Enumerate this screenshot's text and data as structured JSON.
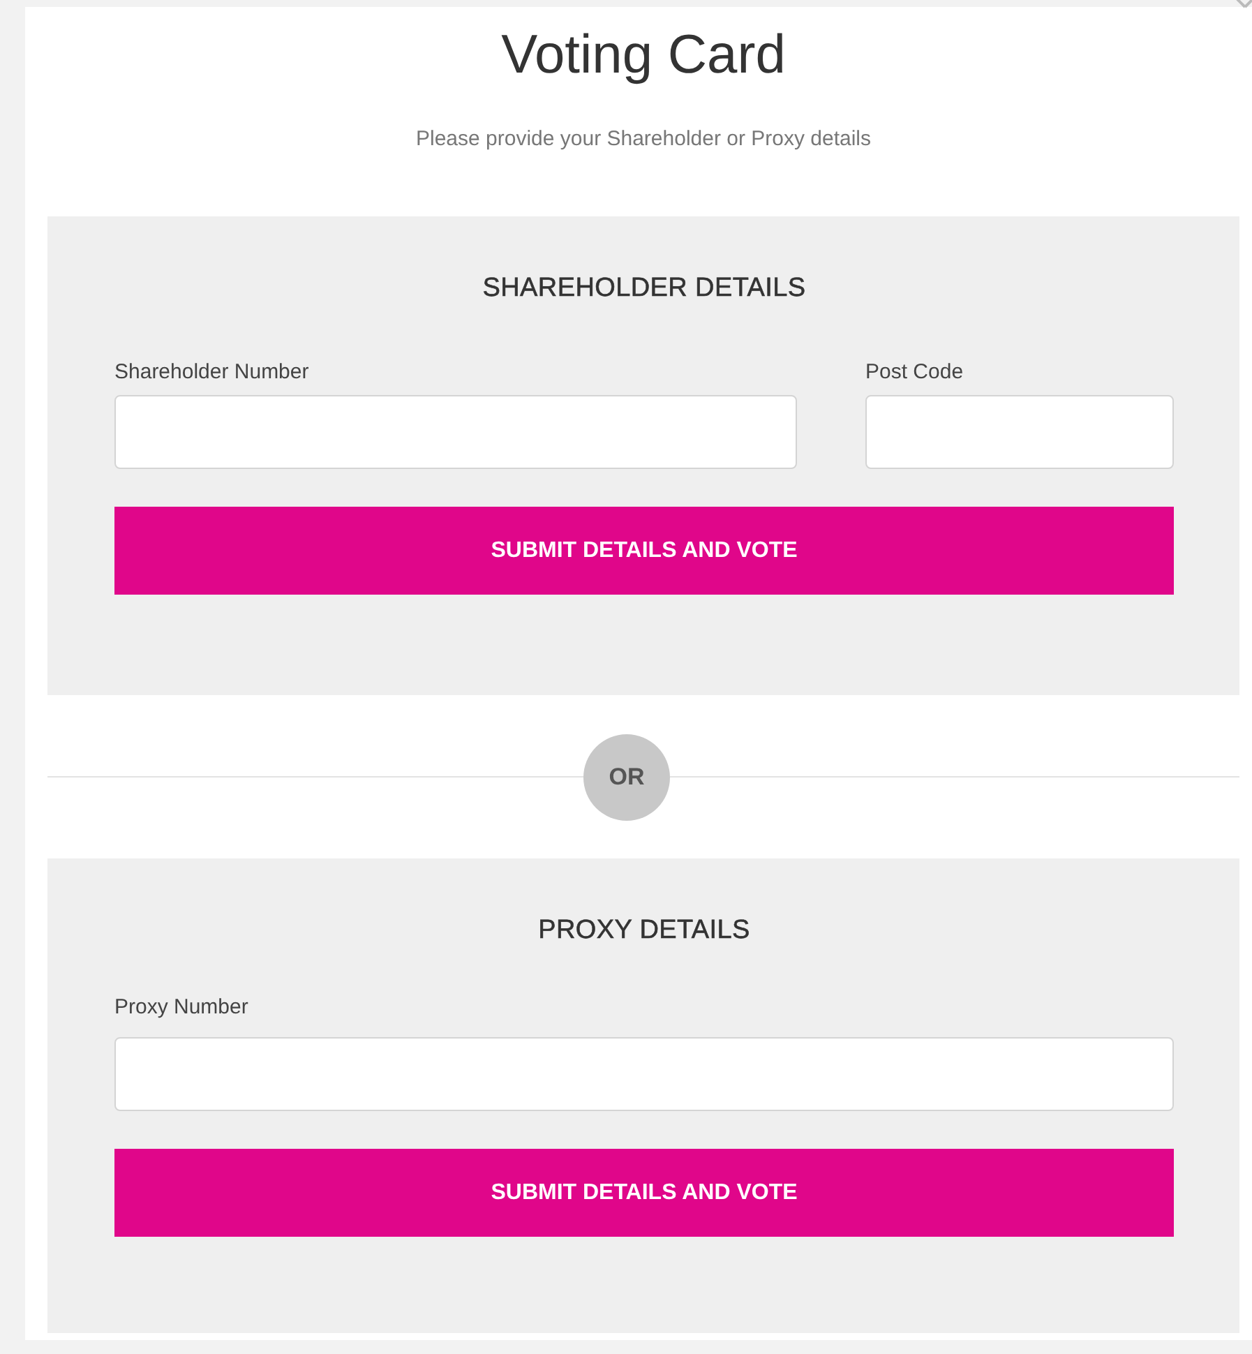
{
  "window": {
    "title": "Voting Card",
    "subtitle": "Please provide your Shareholder or Proxy details"
  },
  "panels": [
    {
      "heading": "SHAREHOLDER DETAILS",
      "fields": [
        {
          "label": "Shareholder Number"
        },
        {
          "label": "Post Code"
        }
      ],
      "button": "SUBMIT DETAILS AND VOTE"
    },
    {
      "heading": "PROXY DETAILS",
      "fields": [
        {
          "label": "Proxy Number"
        }
      ],
      "button": "SUBMIT DETAILS AND VOTE"
    }
  ],
  "divider": "OR"
}
